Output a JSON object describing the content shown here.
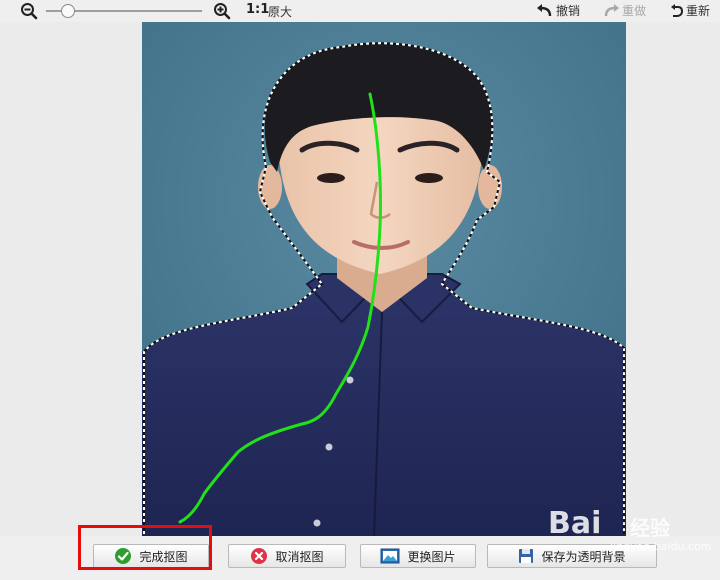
{
  "toolbar": {
    "ratio_label": "1:1",
    "original_label": "原大",
    "undo_label": "撤销",
    "redo_label": "重做",
    "reset_label": "重新",
    "zoom_level": 0.14,
    "icons": [
      "zoom-out-icon",
      "zoom-in-icon",
      "undo-icon",
      "redo-icon",
      "reset-icon"
    ]
  },
  "buttons": {
    "finish_label": "完成抠图",
    "cancel_label": "取消抠图",
    "change_label": "更换图片",
    "save_label": "保存为透明背景"
  },
  "watermark": {
    "logo": "Bai",
    "sub": "经验",
    "url": "jingyan.baidu.com"
  },
  "colors": {
    "highlight": "#e20d0d",
    "stroke": "#22e01a",
    "finish_icon": "#2e9e2e",
    "cancel_icon": "#e0334a",
    "photo_bg": "#477a92",
    "shirt": "#232a5c"
  }
}
